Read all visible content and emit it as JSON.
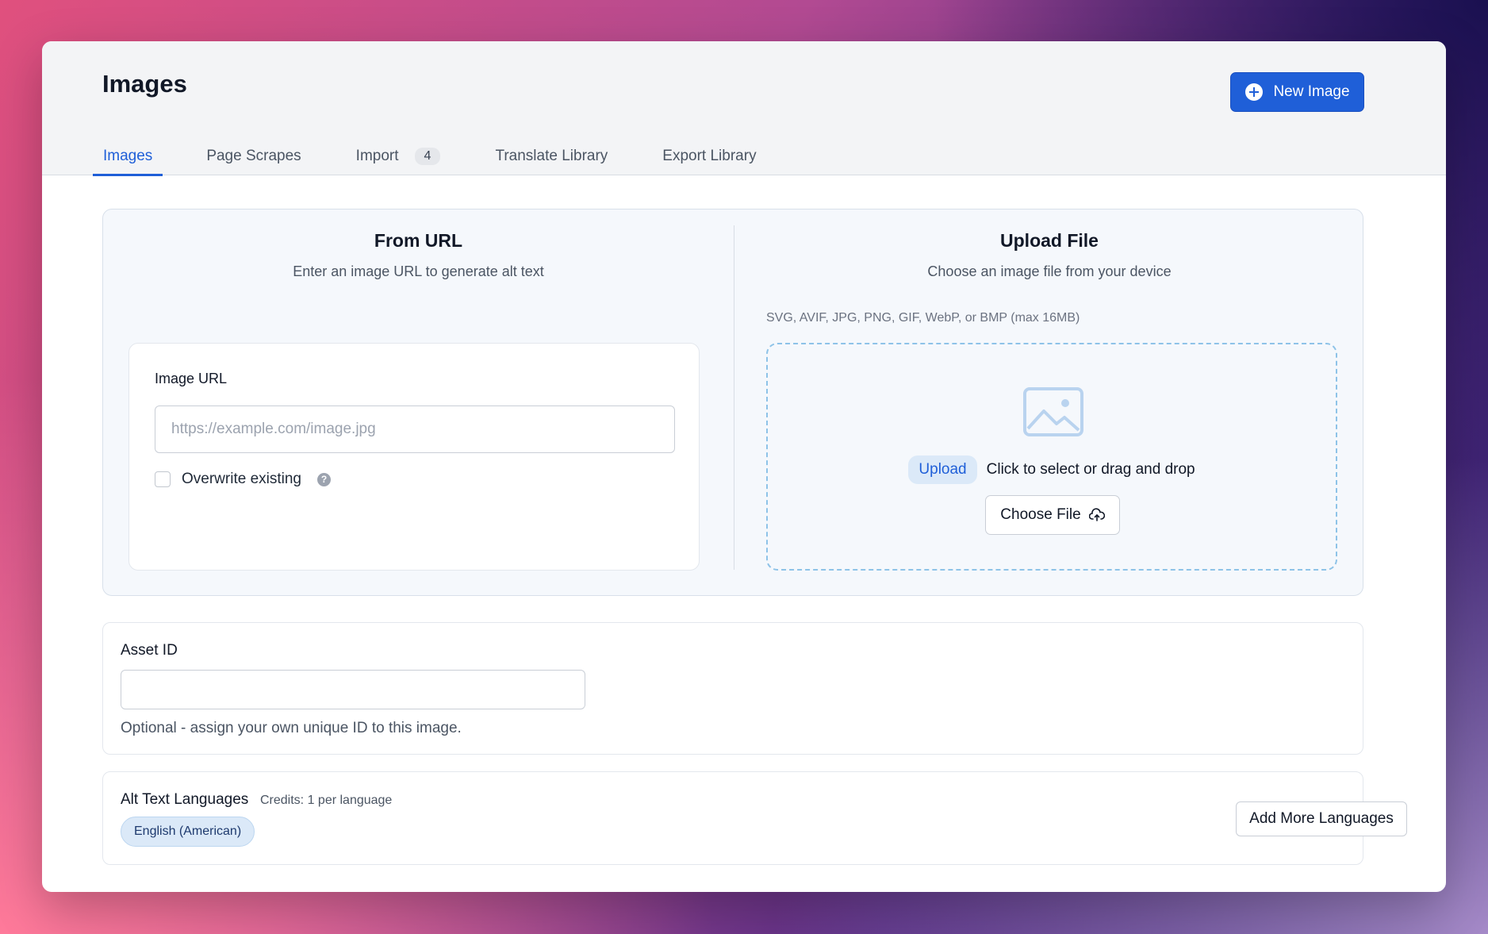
{
  "header": {
    "title": "Images",
    "new_button_label": "New Image"
  },
  "tabs": [
    {
      "label": "Images",
      "active": true
    },
    {
      "label": "Page Scrapes"
    },
    {
      "label": "Import",
      "badge": "4"
    },
    {
      "label": "Translate Library"
    },
    {
      "label": "Export Library"
    }
  ],
  "from_url": {
    "title": "From URL",
    "subtitle": "Enter an image URL to generate alt text",
    "field_label": "Image URL",
    "placeholder": "https://example.com/image.jpg",
    "value": "",
    "overwrite_label": "Overwrite existing",
    "overwrite_checked": false,
    "help_icon": "?"
  },
  "upload_file": {
    "title": "Upload File",
    "subtitle": "Choose an image file from your device",
    "formats": "SVG, AVIF, JPG, PNG, GIF, WebP, or BMP (max 16MB)",
    "upload_pill": "Upload",
    "drop_text": "Click to select or drag and drop",
    "choose_label": "Choose File"
  },
  "asset": {
    "label": "Asset ID",
    "value": "",
    "help": "Optional - assign your own unique ID to this image."
  },
  "languages": {
    "label": "Alt Text Languages",
    "credits": "Credits: 1 per language",
    "selected": [
      "English (American)"
    ],
    "add_label": "Add More Languages"
  },
  "colors": {
    "accent": "#1f5fd8",
    "pill_bg": "#dbe9f8",
    "dropzone_border": "#8ec3e8"
  },
  "icons": {
    "new_button": "plus-circle-icon",
    "help": "question-circle-icon",
    "dropzone": "image-icon",
    "choose": "cloud-upload-icon"
  }
}
